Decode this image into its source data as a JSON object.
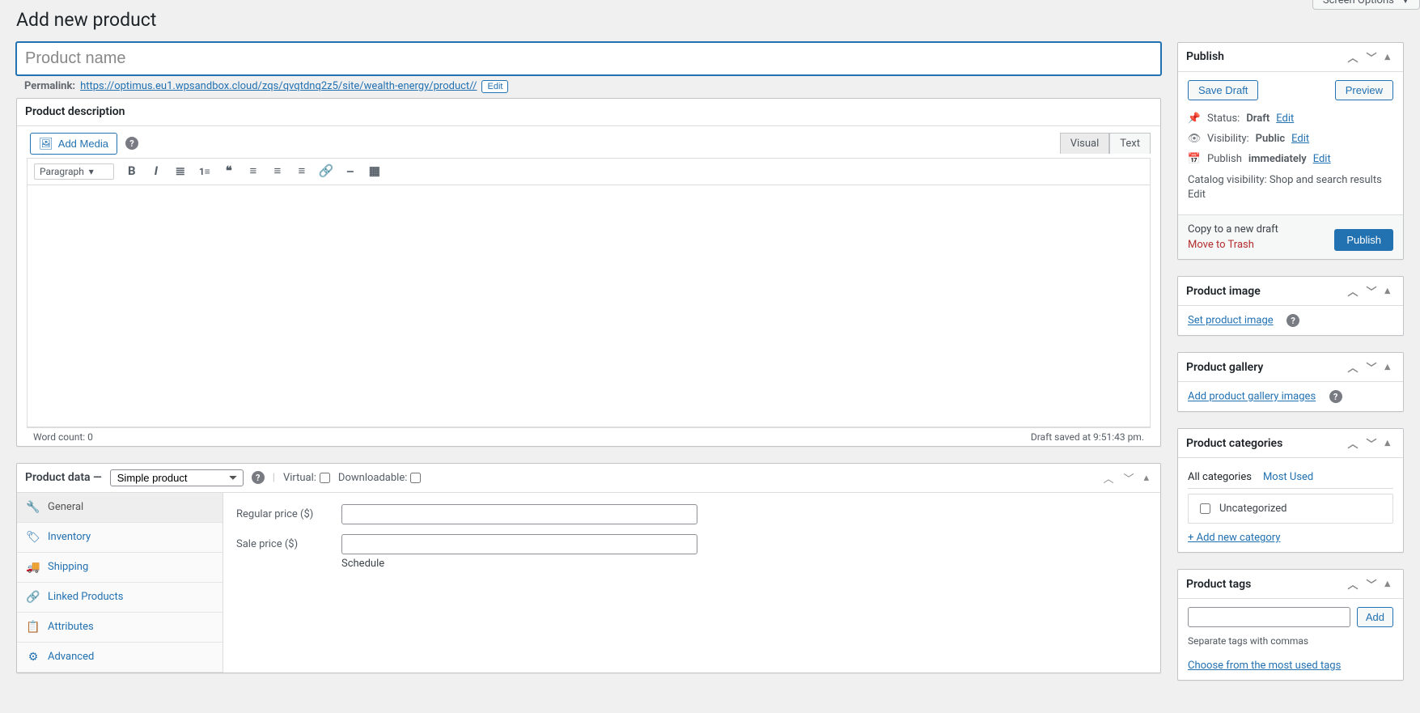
{
  "header": {
    "page_title": "Add new product",
    "screen_options": "Screen Options"
  },
  "title_field": {
    "placeholder": "Product name",
    "value": ""
  },
  "permalink": {
    "label": "Permalink:",
    "url": "https://optimus.eu1.wpsandbox.cloud/zqs/qvqtdnq2z5/site/wealth-energy/product//",
    "edit": "Edit"
  },
  "description": {
    "box_title": "Product description",
    "add_media": "Add Media",
    "tabs": {
      "visual": "Visual",
      "text": "Text"
    },
    "format_select": "Paragraph",
    "word_count_label": "Word count: 0",
    "autosave": "Draft saved at 9:51:43 pm."
  },
  "product_data": {
    "label": "Product data —",
    "type": "Simple product",
    "virtual_label": "Virtual:",
    "downloadable_label": "Downloadable:",
    "tabs": {
      "general": "General",
      "inventory": "Inventory",
      "shipping": "Shipping",
      "linked": "Linked Products",
      "attributes": "Attributes",
      "advanced": "Advanced"
    },
    "fields": {
      "regular_price": "Regular price ($)",
      "sale_price": "Sale price ($)",
      "schedule": "Schedule"
    }
  },
  "publish": {
    "title": "Publish",
    "save_draft": "Save Draft",
    "preview": "Preview",
    "status_label": "Status:",
    "status_value": "Draft",
    "visibility_label": "Visibility:",
    "visibility_value": "Public",
    "publish_label": "Publish",
    "publish_value": "immediately",
    "catalog_label": "Catalog visibility:",
    "catalog_value": "Shop and search results",
    "edit": "Edit",
    "copy_link": "Copy to a new draft",
    "trash_link": "Move to Trash",
    "publish_btn": "Publish"
  },
  "product_image": {
    "title": "Product image",
    "link": "Set product image"
  },
  "product_gallery": {
    "title": "Product gallery",
    "link": "Add product gallery images"
  },
  "product_categories": {
    "title": "Product categories",
    "tab_all": "All categories",
    "tab_most": "Most Used",
    "item_uncat": "Uncategorized",
    "add_new": "+ Add new category"
  },
  "product_tags": {
    "title": "Product tags",
    "add_btn": "Add",
    "hint": "Separate tags with commas",
    "choose": "Choose from the most used tags"
  }
}
